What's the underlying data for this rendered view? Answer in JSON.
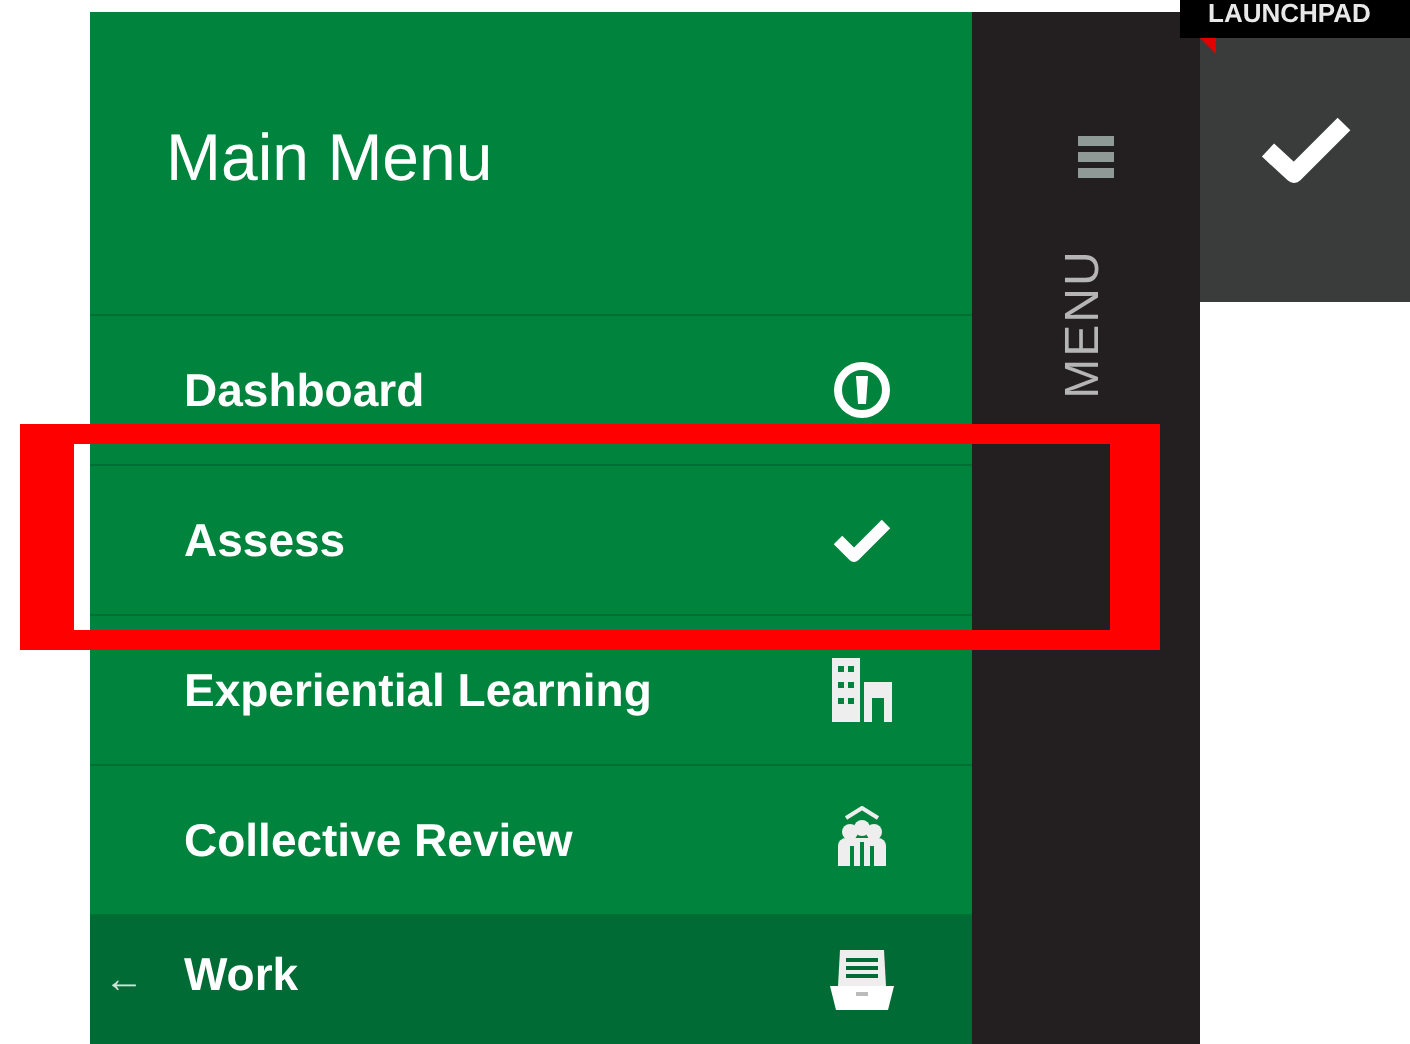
{
  "menu": {
    "title": "Main Menu",
    "items": [
      {
        "label": "Dashboard",
        "kind": "link",
        "highlighted": false
      },
      {
        "label": "Assess",
        "kind": "link",
        "highlighted": true
      },
      {
        "label": "Experiential Learning",
        "kind": "link",
        "highlighted": false
      },
      {
        "label": "Collective Review",
        "kind": "link",
        "highlighted": false
      },
      {
        "label": "Work",
        "kind": "back",
        "back_glyph": "←",
        "highlighted": false
      }
    ]
  },
  "side_strip": {
    "label": "MENU"
  },
  "launchpad": {
    "label": "LAUNCHPAD"
  }
}
